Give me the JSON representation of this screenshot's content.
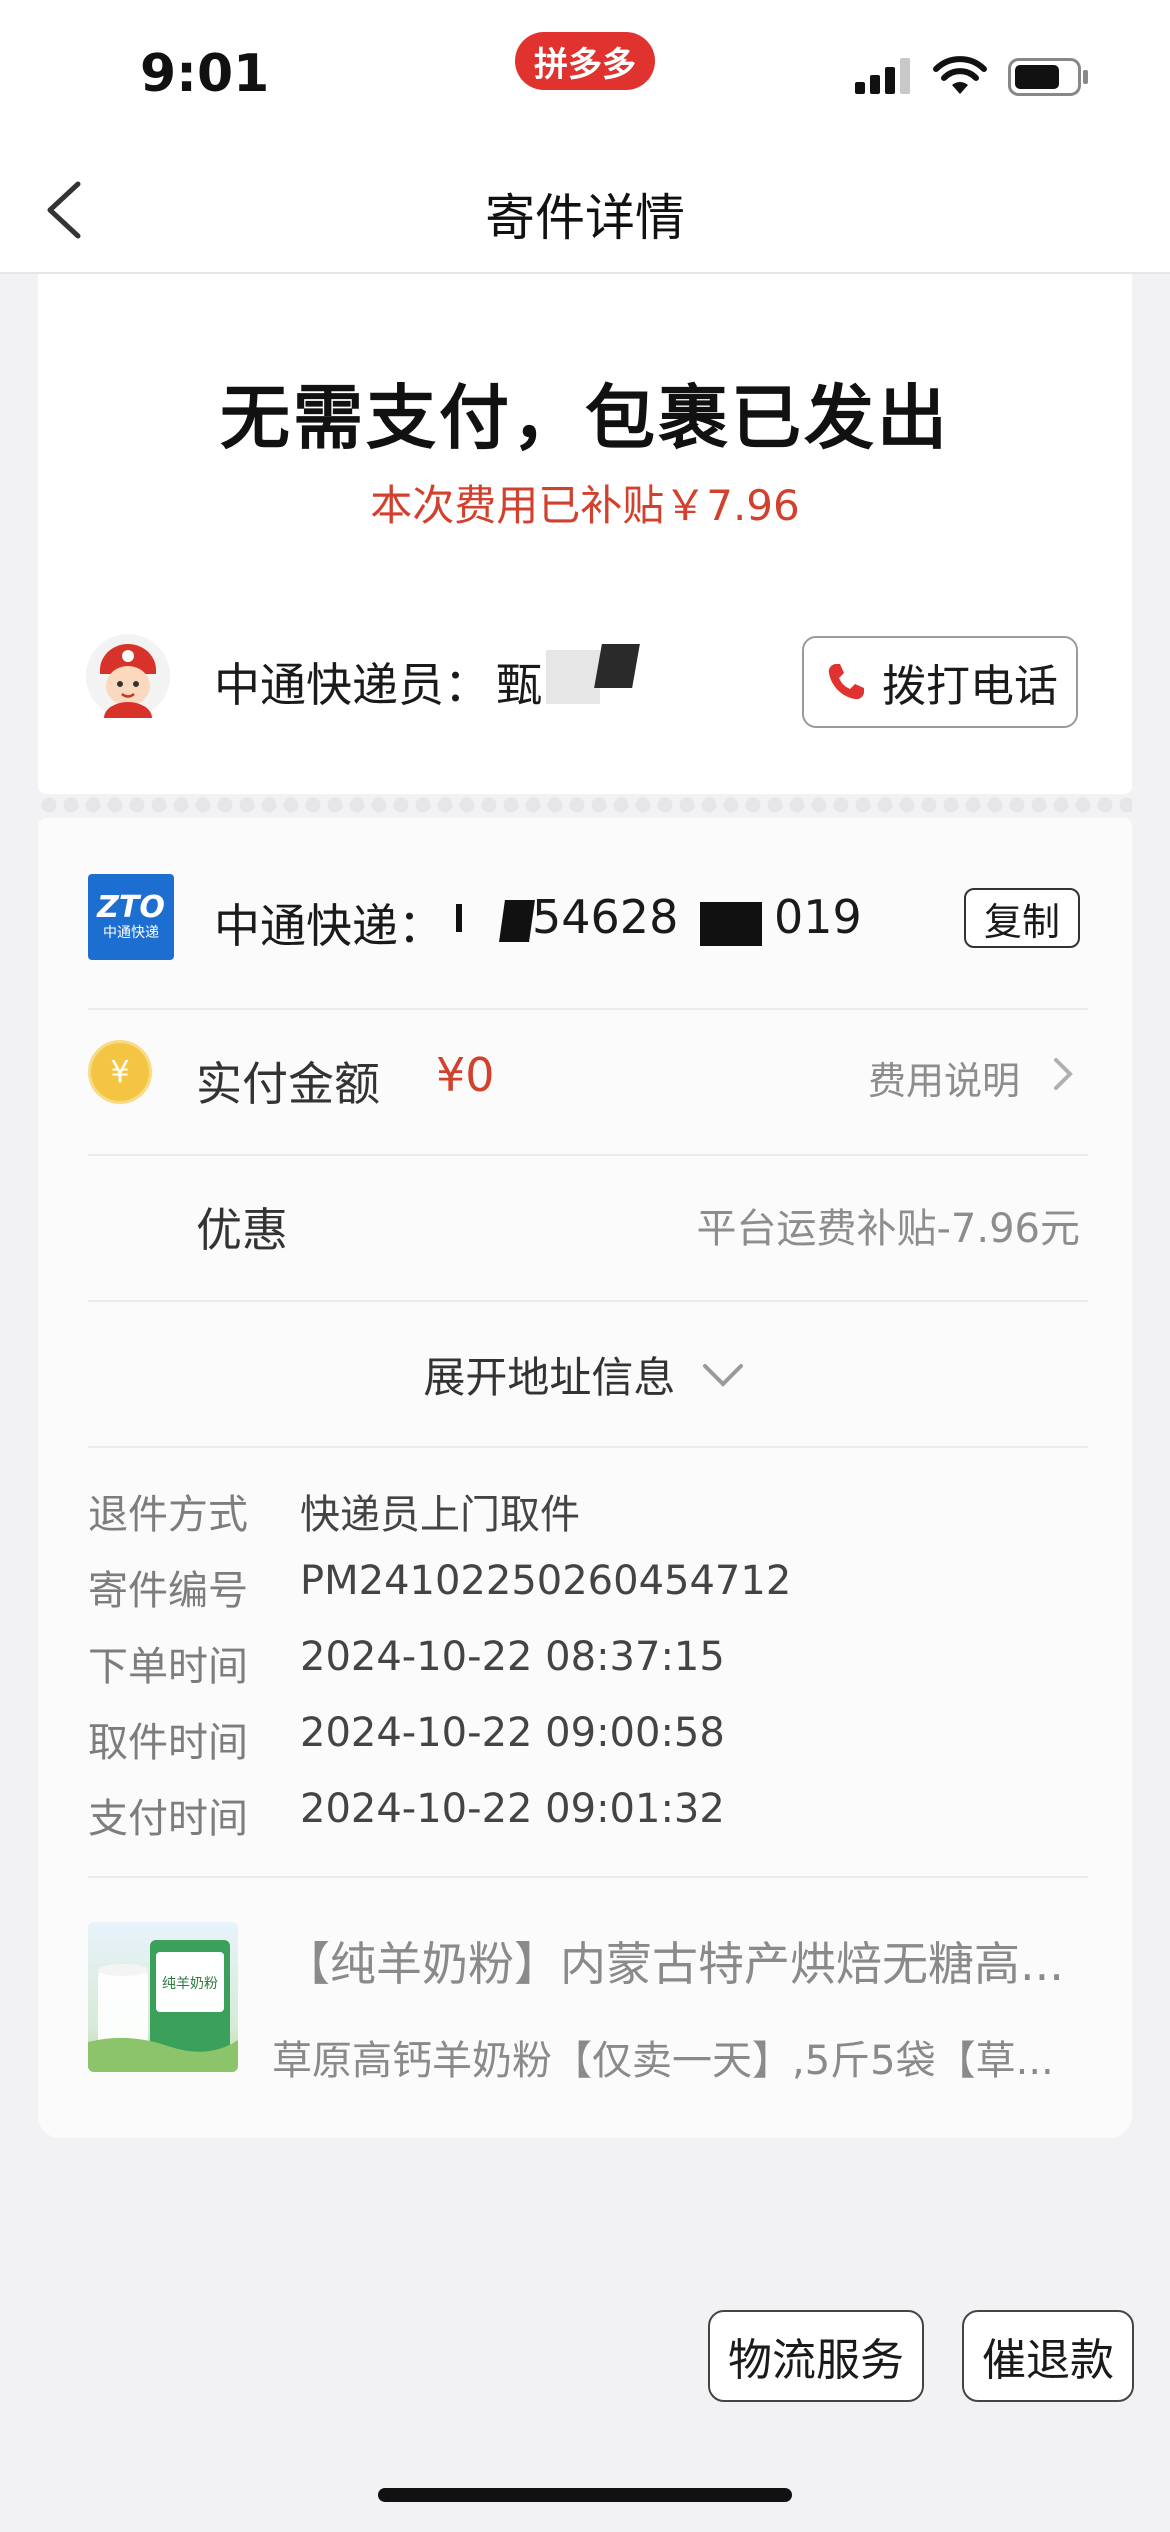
{
  "status_bar": {
    "time": "9:01",
    "app_badge": "拼多多"
  },
  "nav": {
    "title": "寄件详情",
    "back_icon": "chevron-left-icon"
  },
  "summary": {
    "headline": "无需支付，包裹已发出",
    "subsidy_text": "本次费用已补贴￥7.96"
  },
  "courier": {
    "label": "中通快递员：",
    "name_visible": "甄",
    "call_button": "拨打电话"
  },
  "shipment": {
    "carrier_label": "中通快递：",
    "logo_text": "ZTO",
    "logo_subtext": "中通快递",
    "tracking_part1": "54628",
    "tracking_part2": "019",
    "copy_button": "复制"
  },
  "payment": {
    "label": "实付金额",
    "amount": "¥0",
    "fee_link": "费用说明",
    "coin_symbol": "¥"
  },
  "discount": {
    "label": "优惠",
    "value": "平台运费补贴-7.96元"
  },
  "expand_address": "展开地址信息",
  "details": [
    {
      "label": "退件方式",
      "value": "快递员上门取件"
    },
    {
      "label": "寄件编号",
      "value": "PM24102250260454712"
    },
    {
      "label": "下单时间",
      "value": "2024-10-22 08:37:15"
    },
    {
      "label": "取件时间",
      "value": "2024-10-22 09:00:58"
    },
    {
      "label": "支付时间",
      "value": "2024-10-22 09:01:32"
    }
  ],
  "product": {
    "title": "【纯羊奶粉】内蒙古特产烘焙无糖高...",
    "subtitle": "草原高钙羊奶粉【仅卖一天】,5斤5袋【草...",
    "image_text": "纯羊奶粉"
  },
  "actions": {
    "logistics": "物流服务",
    "refund": "催退款"
  },
  "colors": {
    "accent_red": "#d2412d",
    "brand_red": "#e0322f",
    "zto_blue": "#1c6fd1"
  }
}
